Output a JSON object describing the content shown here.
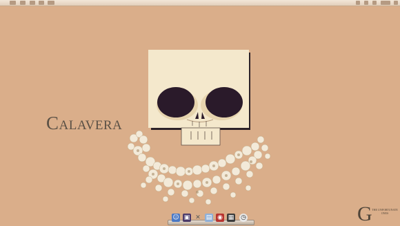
{
  "wallpaper": {
    "title": "Calavera",
    "background_color": "#daae8a",
    "skull_color": "#f4e8cc",
    "eye_color": "#2a1a2a"
  },
  "corner_logo": {
    "letter": "G",
    "text": "The Unfortunate Ones"
  },
  "dock": {
    "icons": [
      "finder-icon",
      "photo-icon",
      "tools-icon",
      "preview-icon",
      "photo-booth-icon",
      "calendar-icon",
      "clock-icon"
    ]
  },
  "menubar": {
    "apple_icon": "apple-icon"
  }
}
